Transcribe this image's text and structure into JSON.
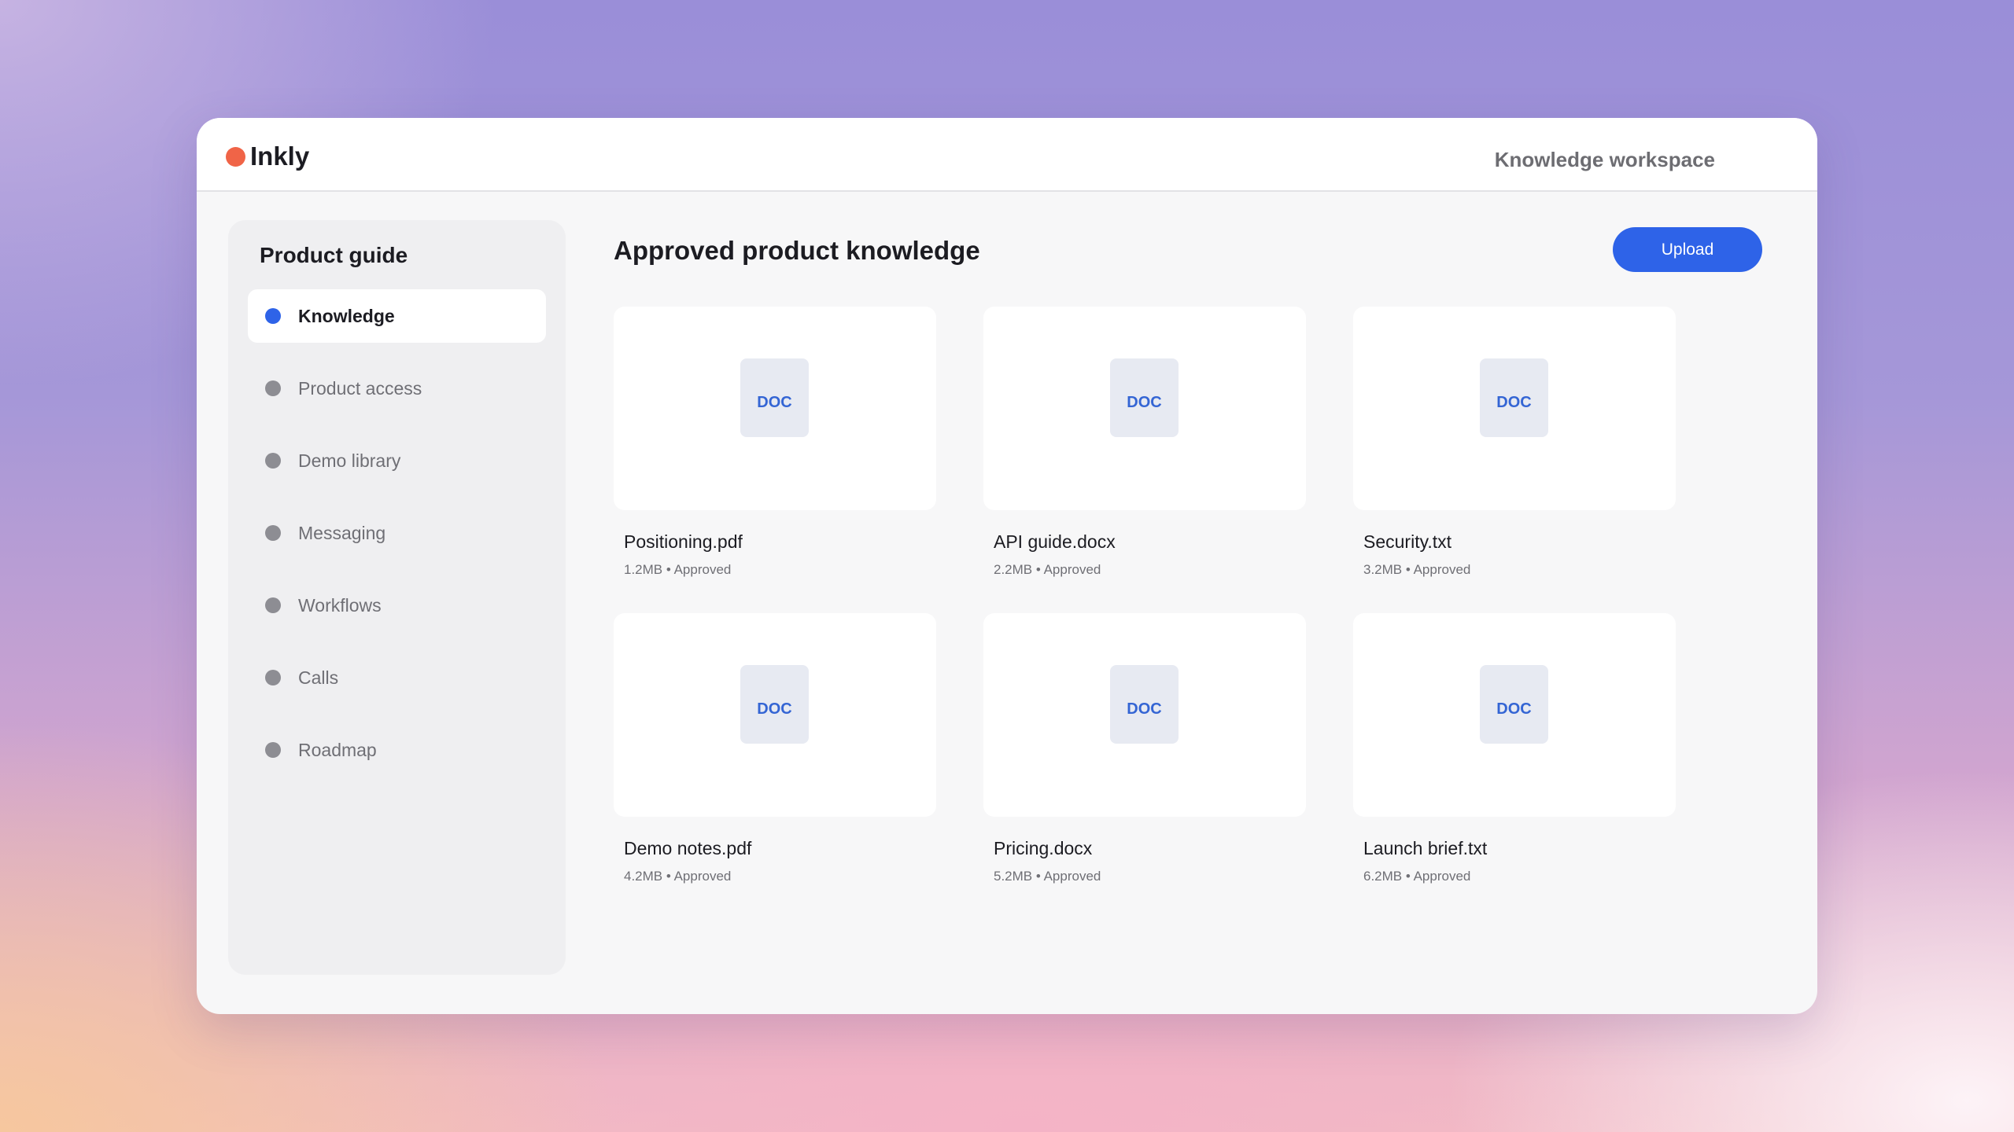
{
  "app": {
    "name": "Inkly",
    "workspace": "Knowledge workspace"
  },
  "colors": {
    "accent": "#2e63e8",
    "brand_dot": "#f06447"
  },
  "sidebar": {
    "title": "Product guide",
    "items": [
      {
        "label": "Knowledge",
        "active": true
      },
      {
        "label": "Product access",
        "active": false
      },
      {
        "label": "Demo library",
        "active": false
      },
      {
        "label": "Messaging",
        "active": false
      },
      {
        "label": "Workflows",
        "active": false
      },
      {
        "label": "Calls",
        "active": false
      },
      {
        "label": "Roadmap",
        "active": false
      }
    ]
  },
  "main": {
    "title": "Approved product knowledge",
    "upload_label": "Upload",
    "files": [
      {
        "icon_label": "DOC",
        "name": "Positioning.pdf",
        "meta": "1.2MB • Approved"
      },
      {
        "icon_label": "DOC",
        "name": "API guide.docx",
        "meta": "2.2MB • Approved"
      },
      {
        "icon_label": "DOC",
        "name": "Security.txt",
        "meta": "3.2MB • Approved"
      },
      {
        "icon_label": "DOC",
        "name": "Demo notes.pdf",
        "meta": "4.2MB • Approved"
      },
      {
        "icon_label": "DOC",
        "name": "Pricing.docx",
        "meta": "5.2MB • Approved"
      },
      {
        "icon_label": "DOC",
        "name": "Launch brief.txt",
        "meta": "6.2MB • Approved"
      }
    ]
  }
}
